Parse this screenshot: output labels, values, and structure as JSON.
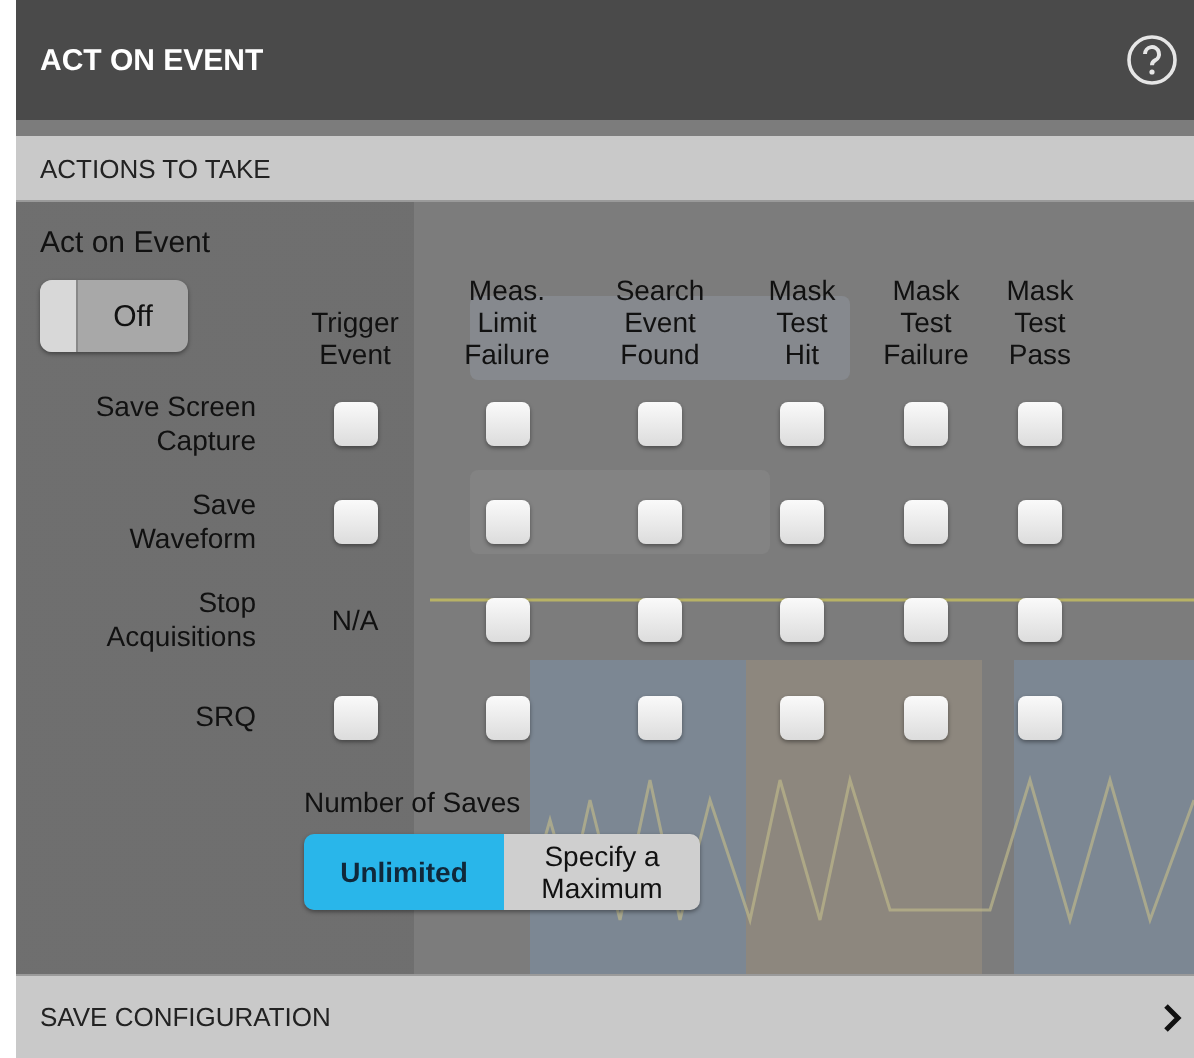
{
  "window": {
    "title": "ACT ON EVENT"
  },
  "section": {
    "title": "ACTIONS TO TAKE"
  },
  "act_on_event": {
    "label": "Act on Event",
    "toggle": {
      "label": "Off",
      "on": false
    }
  },
  "columns": [
    "Trigger\nEvent",
    "Meas.\nLimit\nFailure",
    "Search\nEvent\nFound",
    "Mask\nTest\nHit",
    "Mask\nTest\nFailure",
    "Mask\nTest\nPass"
  ],
  "rows": [
    {
      "label": "Save Screen\nCapture",
      "cells": [
        {
          "kind": "checkbox",
          "checked": false
        },
        {
          "kind": "checkbox",
          "checked": false
        },
        {
          "kind": "checkbox",
          "checked": false
        },
        {
          "kind": "checkbox",
          "checked": false
        },
        {
          "kind": "checkbox",
          "checked": false
        },
        {
          "kind": "checkbox",
          "checked": false
        }
      ]
    },
    {
      "label": "Save\nWaveform",
      "cells": [
        {
          "kind": "checkbox",
          "checked": false
        },
        {
          "kind": "checkbox",
          "checked": false
        },
        {
          "kind": "checkbox",
          "checked": false
        },
        {
          "kind": "checkbox",
          "checked": false
        },
        {
          "kind": "checkbox",
          "checked": false
        },
        {
          "kind": "checkbox",
          "checked": false
        }
      ]
    },
    {
      "label": "Stop\nAcquisitions",
      "cells": [
        {
          "kind": "text",
          "text": "N/A"
        },
        {
          "kind": "checkbox",
          "checked": false
        },
        {
          "kind": "checkbox",
          "checked": false
        },
        {
          "kind": "checkbox",
          "checked": false
        },
        {
          "kind": "checkbox",
          "checked": false
        },
        {
          "kind": "checkbox",
          "checked": false
        }
      ]
    },
    {
      "label": "SRQ",
      "cells": [
        {
          "kind": "checkbox",
          "checked": false
        },
        {
          "kind": "checkbox",
          "checked": false
        },
        {
          "kind": "checkbox",
          "checked": false
        },
        {
          "kind": "checkbox",
          "checked": false
        },
        {
          "kind": "checkbox",
          "checked": false
        },
        {
          "kind": "checkbox",
          "checked": false
        }
      ]
    }
  ],
  "number_of_saves": {
    "label": "Number of Saves",
    "options": [
      {
        "label": "Unlimited",
        "selected": true
      },
      {
        "label": "Specify a\nMaximum",
        "selected": false
      }
    ]
  },
  "footer": {
    "title": "SAVE CONFIGURATION"
  }
}
